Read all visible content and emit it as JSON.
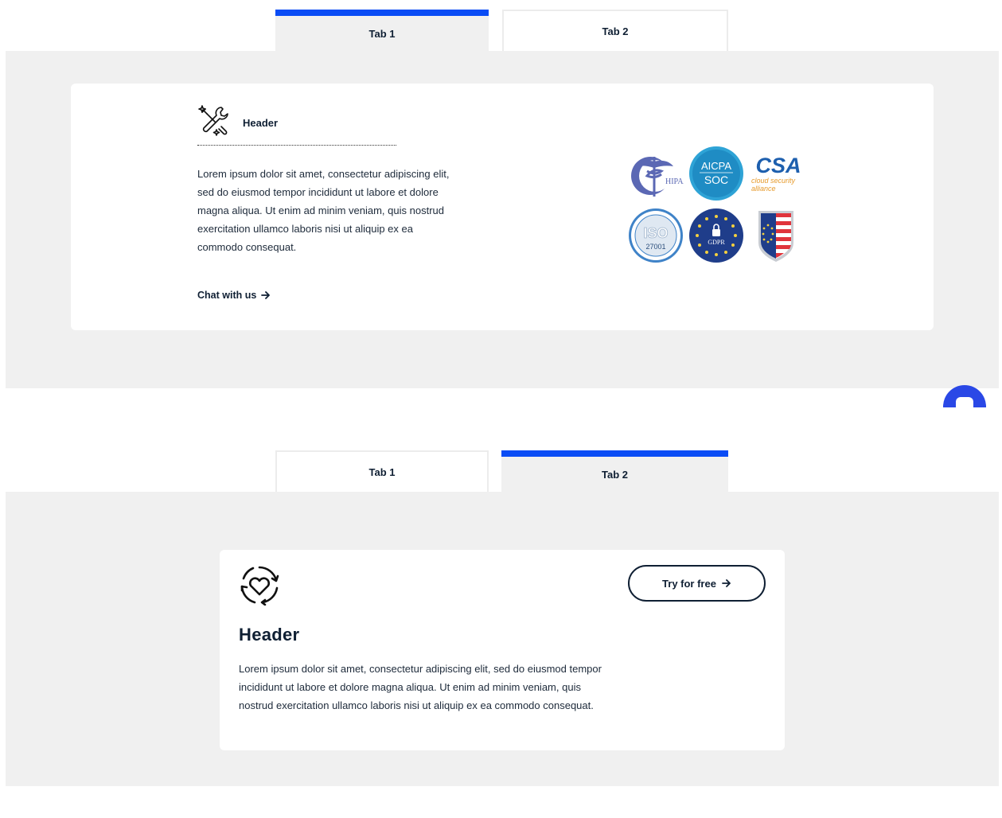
{
  "section1": {
    "tabs": [
      {
        "label": "Tab 1",
        "active": true
      },
      {
        "label": "Tab 2",
        "active": false
      }
    ],
    "card": {
      "icon": "tools-sparkle-icon",
      "header": "Header",
      "body": "Lorem ipsum dolor sit amet, consectetur adipiscing elit, sed do eiusmod tempor incididunt ut labore et dolore magna aliqua. Ut enim ad minim veniam, quis nostrud exercitation ullamco laboris nisi ut aliquip ex ea commodo consequat.",
      "link_label": "Chat with us"
    },
    "badges": {
      "hipaa": "HIPAA",
      "aicpa_top": "AICPA",
      "aicpa_bottom": "SOC",
      "csa_main": "CSA",
      "csa_sub1": "cloud security",
      "csa_sub2": "alliance",
      "iso_main": "ISO",
      "iso_num": "27001",
      "gdpr": "GDPR"
    }
  },
  "section2": {
    "tabs": [
      {
        "label": "Tab 1",
        "active": false
      },
      {
        "label": "Tab 2",
        "active": true
      }
    ],
    "card": {
      "icon": "heart-cycle-icon",
      "header": "Header",
      "body": "Lorem ipsum dolor sit amet, consectetur adipiscing elit, sed do eiusmod tempor incididunt ut labore et dolore magna aliqua. Ut enim ad minim veniam, quis nostrud exercitation ullamco laboris nisi ut aliquip ex ea commodo consequat.",
      "button_label": "Try for free"
    }
  },
  "colors": {
    "accent": "#0a4cf5",
    "panel_bg": "#f0f0f0",
    "text": "#0f1f33",
    "chat": "#2a48e6"
  }
}
